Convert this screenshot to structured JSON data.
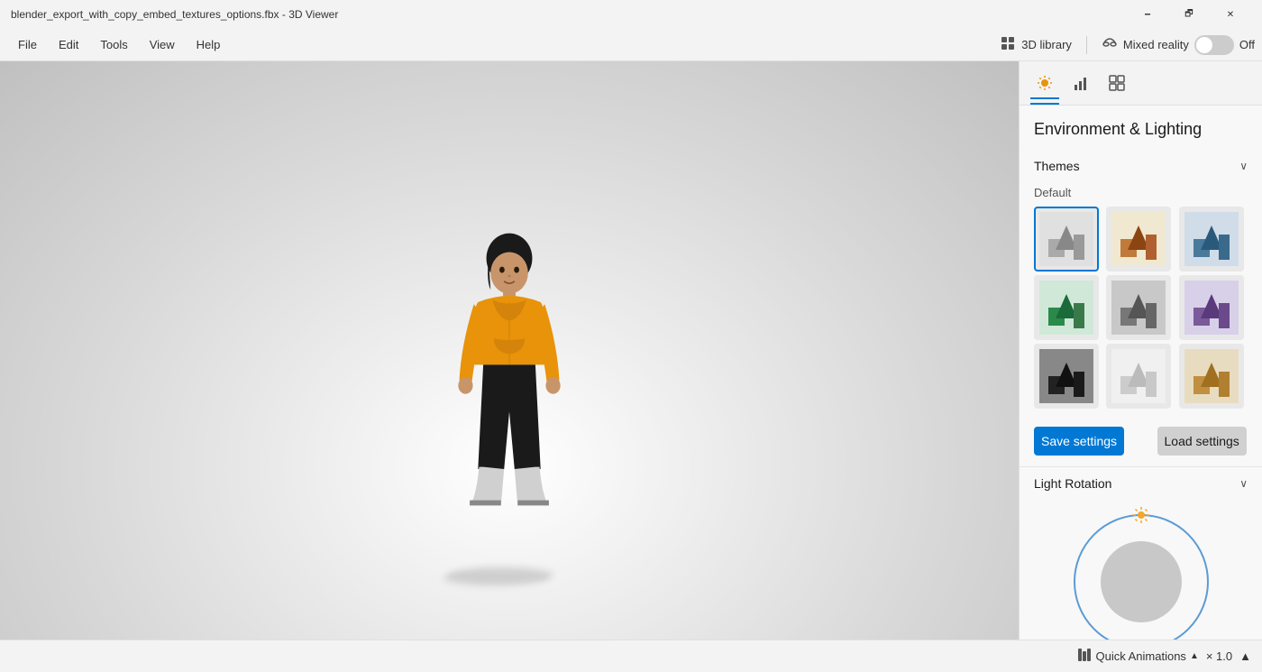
{
  "titlebar": {
    "title": "blender_export_with_copy_embed_textures_options.fbx - 3D Viewer",
    "minimize": "🗕",
    "restore": "🗗",
    "close": "✕"
  },
  "menubar": {
    "items": [
      "File",
      "Edit",
      "Tools",
      "View",
      "Help"
    ],
    "library_label": "3D library",
    "mixed_reality_label": "Mixed reality",
    "toggle_state": "Off"
  },
  "panel": {
    "section_title": "Environment & Lighting",
    "themes": {
      "label": "Themes",
      "default_label": "Default",
      "chevron": "∨"
    },
    "buttons": {
      "save": "Save settings",
      "load": "Load settings"
    },
    "light_rotation": {
      "label": "Light Rotation",
      "chevron": "∨"
    }
  },
  "bottom_bar": {
    "quick_animations_label": "Quick Animations",
    "scale_label": "× 1.0"
  }
}
